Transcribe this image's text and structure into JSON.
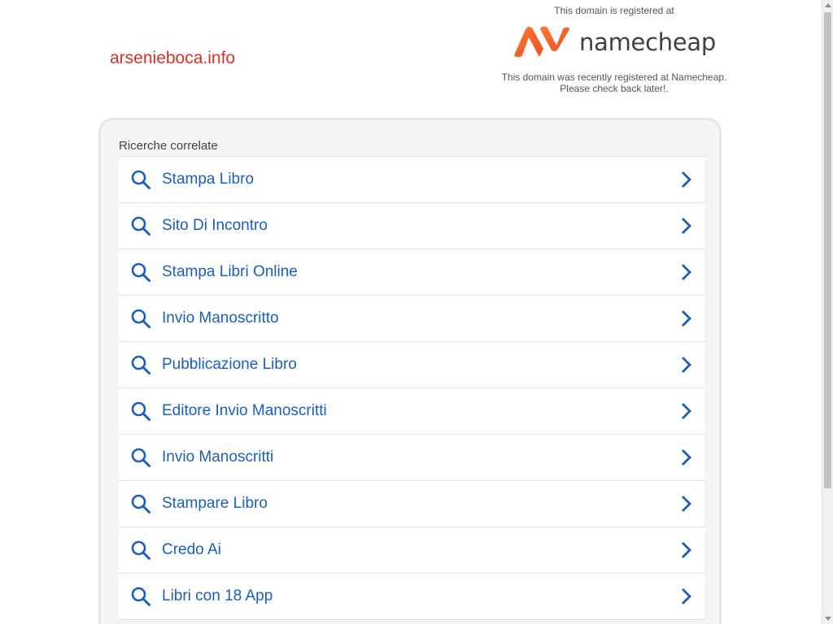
{
  "site": {
    "domain": "arsenieboca.info"
  },
  "registrar": {
    "top_text": "This domain is registered at",
    "logo_text": "namecheap",
    "note_line1": "This domain was recently registered at Namecheap.",
    "note_line2": "Please check back later!."
  },
  "related": {
    "title": "Ricerche correlate",
    "items": [
      {
        "label": "Stampa Libro"
      },
      {
        "label": "Sito Di Incontro"
      },
      {
        "label": "Stampa Libri Online"
      },
      {
        "label": "Invio Manoscritto"
      },
      {
        "label": "Pubblicazione Libro"
      },
      {
        "label": "Editore Invio Manoscritti"
      },
      {
        "label": "Invio Manoscritti"
      },
      {
        "label": "Stampare Libro"
      },
      {
        "label": "Credo Ai"
      },
      {
        "label": "Libri con 18 App"
      }
    ]
  },
  "icons": {
    "item_icon": "search-icon",
    "item_arrow": "chevron-right-icon"
  },
  "colors": {
    "domain_red": "#d93025",
    "link_blue": "#1a5fbf",
    "namecheap_orange": "#ff5a1f"
  }
}
